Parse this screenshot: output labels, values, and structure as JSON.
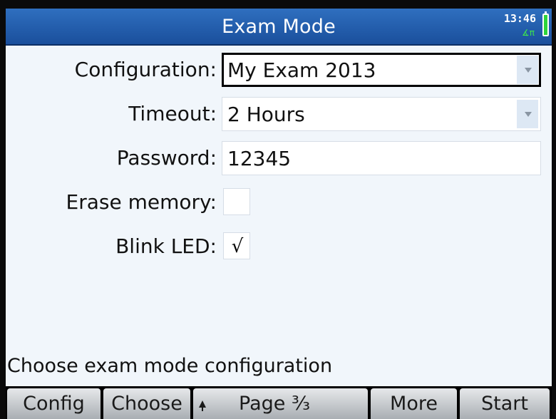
{
  "header": {
    "title": "Exam Mode",
    "clock": "13:46",
    "angle_indicator": "∡π",
    "battery": "battery-icon"
  },
  "form": {
    "configuration": {
      "label": "Configuration:",
      "value": "My Exam 2013"
    },
    "timeout": {
      "label": "Timeout:",
      "value": "2 Hours"
    },
    "password": {
      "label": "Password:",
      "value": "12345"
    },
    "erase_memory": {
      "label": "Erase memory:",
      "checked": false,
      "mark": ""
    },
    "blink_led": {
      "label": "Blink LED:",
      "checked": true,
      "mark": "√"
    }
  },
  "status": "Choose exam mode configuration",
  "menu": {
    "config": "Config",
    "choose": "Choose",
    "page": "Page ³⁄₃",
    "more": "More",
    "start": "Start"
  },
  "colors": {
    "title_bar": "#1a4f9c",
    "screen_background": "#f1f6fb",
    "battery": "#2fd43c",
    "menu_button": "#c8ccd0"
  }
}
